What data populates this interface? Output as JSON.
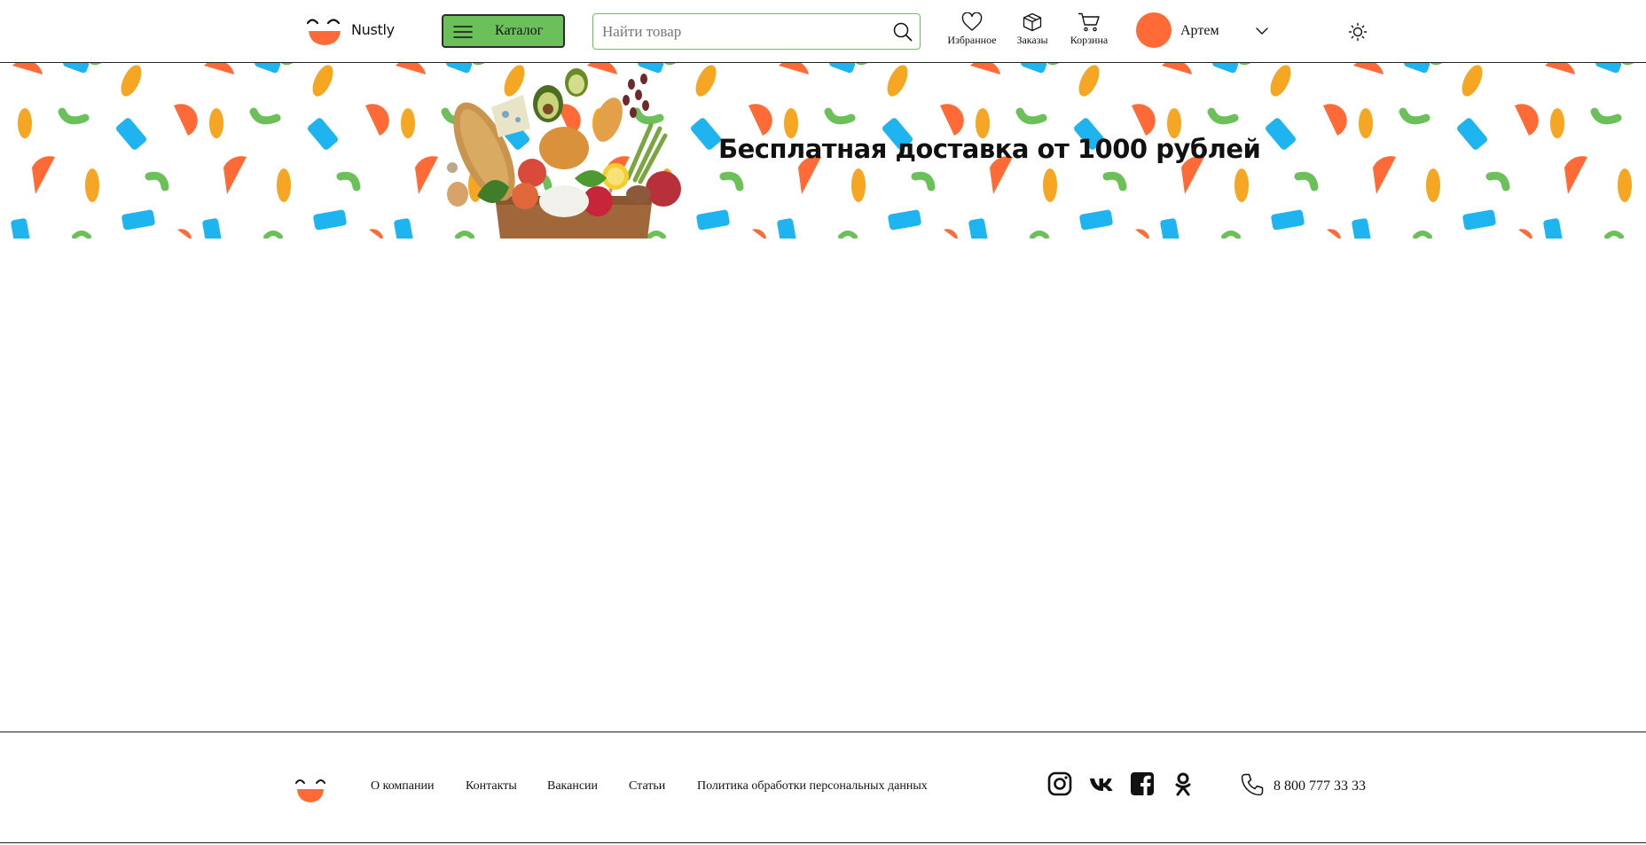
{
  "header": {
    "logo_text": "Nustly",
    "catalog_label": "Каталог",
    "search_placeholder": "Найти товар",
    "search_value": "",
    "nav": {
      "favorites": "Избранное",
      "orders": "Заказы",
      "cart": "Корзина"
    },
    "user_name": "Артем",
    "avatar_color": "#ff6a36"
  },
  "banner": {
    "title": "Бесплатная доставка от 1000 рублей",
    "pattern_colors": [
      "#ff6a36",
      "#f5a623",
      "#6cc05a",
      "#1eb4f0"
    ]
  },
  "footer": {
    "links": [
      "О компании",
      "Контакты",
      "Вакансии",
      "Статьи",
      "Политика обработки персональных данных"
    ],
    "social": [
      "instagram-icon",
      "vk-icon",
      "facebook-icon",
      "odnoklassniki-icon"
    ],
    "phone": "8 800 777 33 33"
  },
  "colors": {
    "accent_green": "#6cc05a",
    "accent_orange": "#ff6a36"
  }
}
